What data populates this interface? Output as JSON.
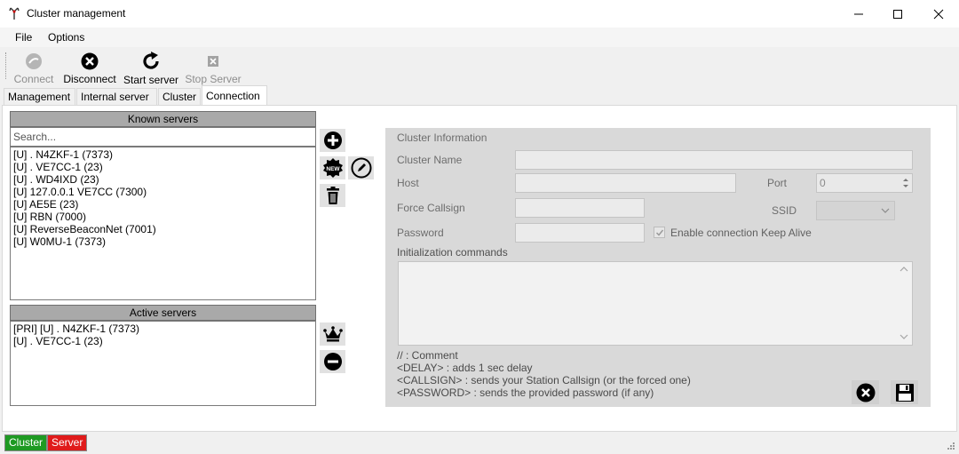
{
  "window": {
    "title": "Cluster management"
  },
  "menu": {
    "file": "File",
    "options": "Options"
  },
  "toolbar": {
    "connect": "Connect",
    "disconnect": "Disconnect",
    "start_server": "Start server",
    "stop_server": "Stop Server"
  },
  "tabs": {
    "management": "Management",
    "internal_server": "Internal server",
    "cluster": "Cluster",
    "connection": "Connection"
  },
  "known_servers": {
    "header": "Known servers",
    "search_placeholder": "Search...",
    "items": [
      "[U] . N4ZKF-1 (7373)",
      "[U] . VE7CC-1 (23)",
      "[U] . WD4IXD (23)",
      "[U] 127.0.0.1 VE7CC (7300)",
      "[U] AE5E (23)",
      "[U] RBN (7000)",
      "[U] ReverseBeaconNet (7001)",
      "[U] W0MU-1 (7373)"
    ]
  },
  "active_servers": {
    "header": "Active servers",
    "items": [
      "[PRI] [U] . N4ZKF-1 (7373)",
      "[U] . VE7CC-1 (23)"
    ]
  },
  "cluster_info": {
    "title": "Cluster Information",
    "cluster_name_label": "Cluster Name",
    "cluster_name_value": "",
    "host_label": "Host",
    "host_value": "",
    "port_label": "Port",
    "port_value": "0",
    "force_callsign_label": "Force Callsign",
    "force_callsign_value": "",
    "ssid_label": "SSID",
    "password_label": "Password",
    "password_value": "",
    "keepalive_label": "Enable connection Keep Alive",
    "init_commands_label": "Initialization commands",
    "init_commands_value": "",
    "hints": [
      "// : Comment",
      "<DELAY> : adds 1 sec delay",
      "<CALLSIGN> : sends your Station Callsign (or the forced one)",
      "<PASSWORD> : sends the provided password (if any)"
    ]
  },
  "status": {
    "cluster": "Cluster",
    "server": "Server"
  },
  "colors": {
    "cluster_status": "#1e9a22",
    "server_status": "#e01b1b",
    "header_bar": "#a9a9a9",
    "info_panel": "#d9d9d9"
  }
}
